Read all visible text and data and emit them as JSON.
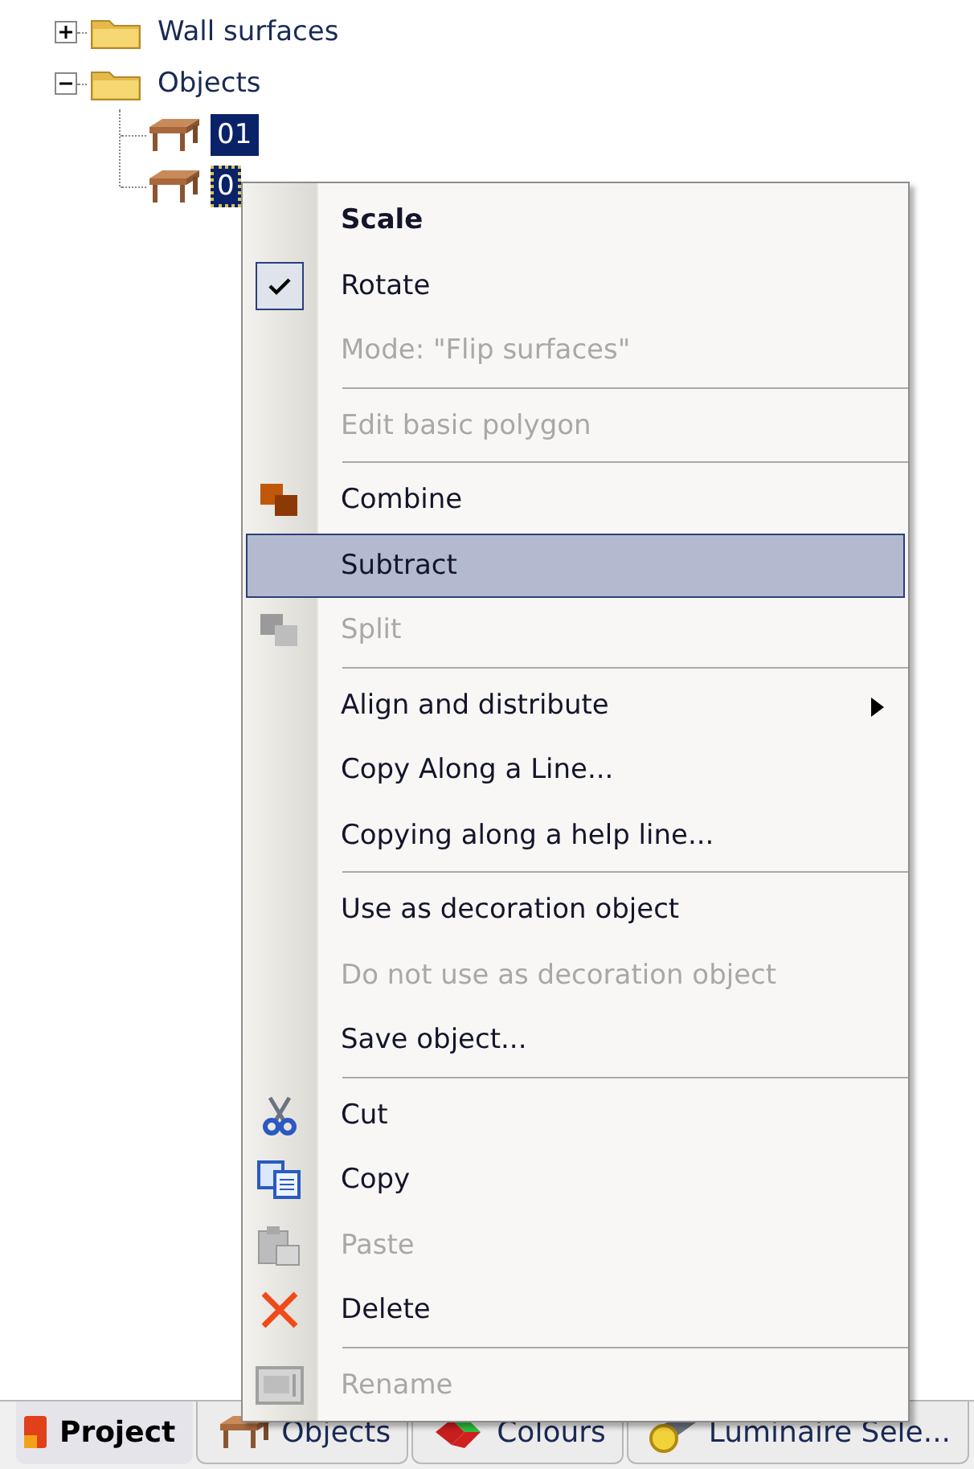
{
  "tree": [
    {
      "label": "Wall surfaces",
      "expanded": false
    },
    {
      "label": "Objects",
      "expanded": true,
      "children": [
        {
          "label": "01",
          "selected": true,
          "focused": false
        },
        {
          "label": "0",
          "selected": true,
          "focused": true
        }
      ]
    }
  ],
  "context_menu": {
    "items": [
      {
        "kind": "item",
        "label": "Scale",
        "default": true,
        "checked": false,
        "disabled": false,
        "selected": false,
        "submenu": false
      },
      {
        "kind": "item",
        "label": "Rotate",
        "default": false,
        "checked": true,
        "disabled": false,
        "selected": false,
        "submenu": false
      },
      {
        "kind": "item",
        "label": "Mode: \"Flip surfaces\"",
        "default": false,
        "checked": false,
        "disabled": true,
        "selected": false,
        "submenu": false
      },
      {
        "kind": "separator"
      },
      {
        "kind": "item",
        "label": "Edit basic polygon",
        "default": false,
        "checked": false,
        "disabled": true,
        "selected": false,
        "submenu": false
      },
      {
        "kind": "separator"
      },
      {
        "kind": "item",
        "label": "Combine",
        "default": false,
        "checked": false,
        "disabled": false,
        "selected": false,
        "submenu": false
      },
      {
        "kind": "item",
        "label": "Subtract",
        "default": false,
        "checked": false,
        "disabled": false,
        "selected": true,
        "submenu": false
      },
      {
        "kind": "item",
        "label": "Split",
        "default": false,
        "checked": false,
        "disabled": true,
        "selected": false,
        "submenu": false
      },
      {
        "kind": "separator"
      },
      {
        "kind": "item",
        "label": "Align and distribute",
        "default": false,
        "checked": false,
        "disabled": false,
        "selected": false,
        "submenu": true
      },
      {
        "kind": "item",
        "label": "Copy Along a Line...",
        "default": false,
        "checked": false,
        "disabled": false,
        "selected": false,
        "submenu": false
      },
      {
        "kind": "item",
        "label": "Copying along a help line...",
        "default": false,
        "checked": false,
        "disabled": false,
        "selected": false,
        "submenu": false
      },
      {
        "kind": "separator"
      },
      {
        "kind": "item",
        "label": "Use as decoration object",
        "default": false,
        "checked": false,
        "disabled": false,
        "selected": false,
        "submenu": false
      },
      {
        "kind": "item",
        "label": "Do not use as decoration object",
        "default": false,
        "checked": false,
        "disabled": true,
        "selected": false,
        "submenu": false
      },
      {
        "kind": "item",
        "label": "Save object...",
        "default": false,
        "checked": false,
        "disabled": false,
        "selected": false,
        "submenu": false
      },
      {
        "kind": "separator"
      },
      {
        "kind": "item",
        "label": "Cut",
        "default": false,
        "checked": false,
        "disabled": false,
        "selected": false,
        "submenu": false
      },
      {
        "kind": "item",
        "label": "Copy",
        "default": false,
        "checked": false,
        "disabled": false,
        "selected": false,
        "submenu": false
      },
      {
        "kind": "item",
        "label": "Paste",
        "default": false,
        "checked": false,
        "disabled": true,
        "selected": false,
        "submenu": false
      },
      {
        "kind": "item",
        "label": "Delete",
        "default": false,
        "checked": false,
        "disabled": false,
        "selected": false,
        "submenu": false
      },
      {
        "kind": "separator"
      },
      {
        "kind": "item",
        "label": "Rename",
        "default": false,
        "checked": false,
        "disabled": true,
        "selected": false,
        "submenu": false
      }
    ]
  },
  "tabs": [
    {
      "label": "Project",
      "selected": true
    },
    {
      "label": "Objects",
      "selected": false
    },
    {
      "label": "Colours",
      "selected": false
    },
    {
      "label": "Luminaire Sele...",
      "selected": false
    }
  ]
}
